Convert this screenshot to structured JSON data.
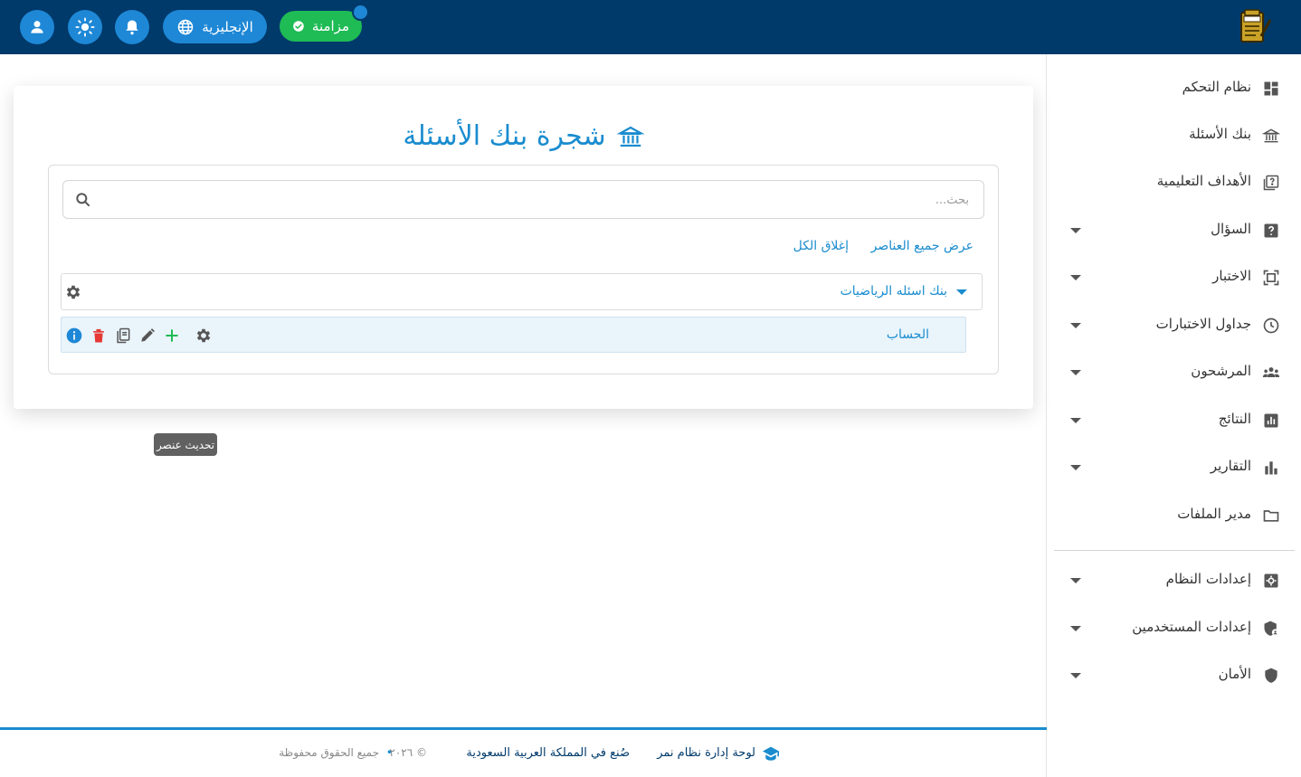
{
  "header": {
    "language_label": "الإنجليزية",
    "sync_label": "مزامنة",
    "icons": [
      "user-icon",
      "sun-icon",
      "bell-icon",
      "globe-icon",
      "check-circle-icon"
    ]
  },
  "sidebar": {
    "items": [
      {
        "label": "نظام التحكم",
        "icon": "dashboard-icon",
        "expandable": false
      },
      {
        "label": "بنك الأسئلة",
        "icon": "bank-icon",
        "expandable": false
      },
      {
        "label": "الأهداف التعليمية",
        "icon": "objectives-icon",
        "expandable": false
      },
      {
        "label": "السؤال",
        "icon": "question-icon",
        "expandable": true
      },
      {
        "label": "الاختبار",
        "icon": "exam-icon",
        "expandable": true
      },
      {
        "label": "جداول الاختبارات",
        "icon": "clock-icon",
        "expandable": true
      },
      {
        "label": "المرشحون",
        "icon": "candidates-icon",
        "expandable": true
      },
      {
        "label": "النتائج",
        "icon": "results-icon",
        "expandable": true
      },
      {
        "label": "التقارير",
        "icon": "reports-icon",
        "expandable": true
      },
      {
        "label": "مدير الملفات",
        "icon": "folder-icon",
        "expandable": false
      },
      {
        "label": "إعدادات النظام",
        "icon": "settings-icon",
        "expandable": true
      },
      {
        "label": "إعدادات المستخدمين",
        "icon": "user-shield-icon",
        "expandable": true
      },
      {
        "label": "الأمان",
        "icon": "shield-icon",
        "expandable": true
      }
    ]
  },
  "main": {
    "title": "شجرة بنك الأسئلة",
    "search_placeholder": "بحث...",
    "show_all_label": "عرض جميع العناصر",
    "collapse_all_label": "إغلاق الكل",
    "root_node": "بنك اسئله الرياضيات",
    "child_node": "الحساب",
    "tooltip": "تحديث عنصر"
  },
  "footer": {
    "brand": "لوحة إدارة نظام نمر",
    "made_in": "صُنع في المملكة العربية السعودية",
    "year": "© ٢٠٢٦",
    "separator": "•",
    "rights": "جميع الحقوق محفوظة"
  },
  "colors": {
    "header_bg": "#003a6b",
    "accent": "#1a8ccf",
    "sync_green": "#1fbb55",
    "delete_red": "#e53935",
    "add_green": "#1fbb55",
    "info_blue": "#1e88d6"
  }
}
